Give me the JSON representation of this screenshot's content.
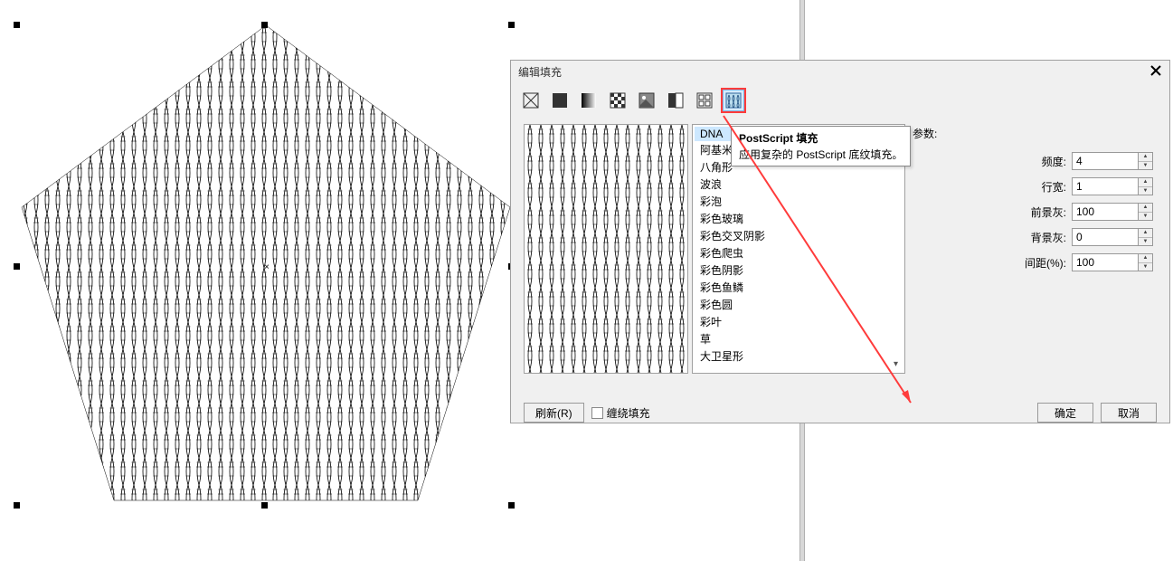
{
  "dialog": {
    "title": "编辑填充",
    "tooltip_title": "PostScript 填充",
    "tooltip_desc": "应用复杂的 PostScript 底纹填充。",
    "params_title": "参数:",
    "refresh_btn": "刷新(R)",
    "spiral_fill_label": "缠绕填充",
    "ok_btn": "确定",
    "cancel_btn": "取消"
  },
  "fill_types": {
    "items": [
      "DNA",
      "阿基米",
      "八角形",
      "波浪",
      "彩泡",
      "彩色玻璃",
      "彩色交叉阴影",
      "彩色爬虫",
      "彩色阴影",
      "彩色鱼鳞",
      "彩色圆",
      "彩叶",
      "草",
      "大卫星形"
    ]
  },
  "params": {
    "rows": [
      {
        "label": "频度:",
        "value": "4"
      },
      {
        "label": "行宽:",
        "value": "1"
      },
      {
        "label": "前景灰:",
        "value": "100"
      },
      {
        "label": "背景灰:",
        "value": "0"
      },
      {
        "label": "间距(%):",
        "value": "100"
      }
    ]
  }
}
